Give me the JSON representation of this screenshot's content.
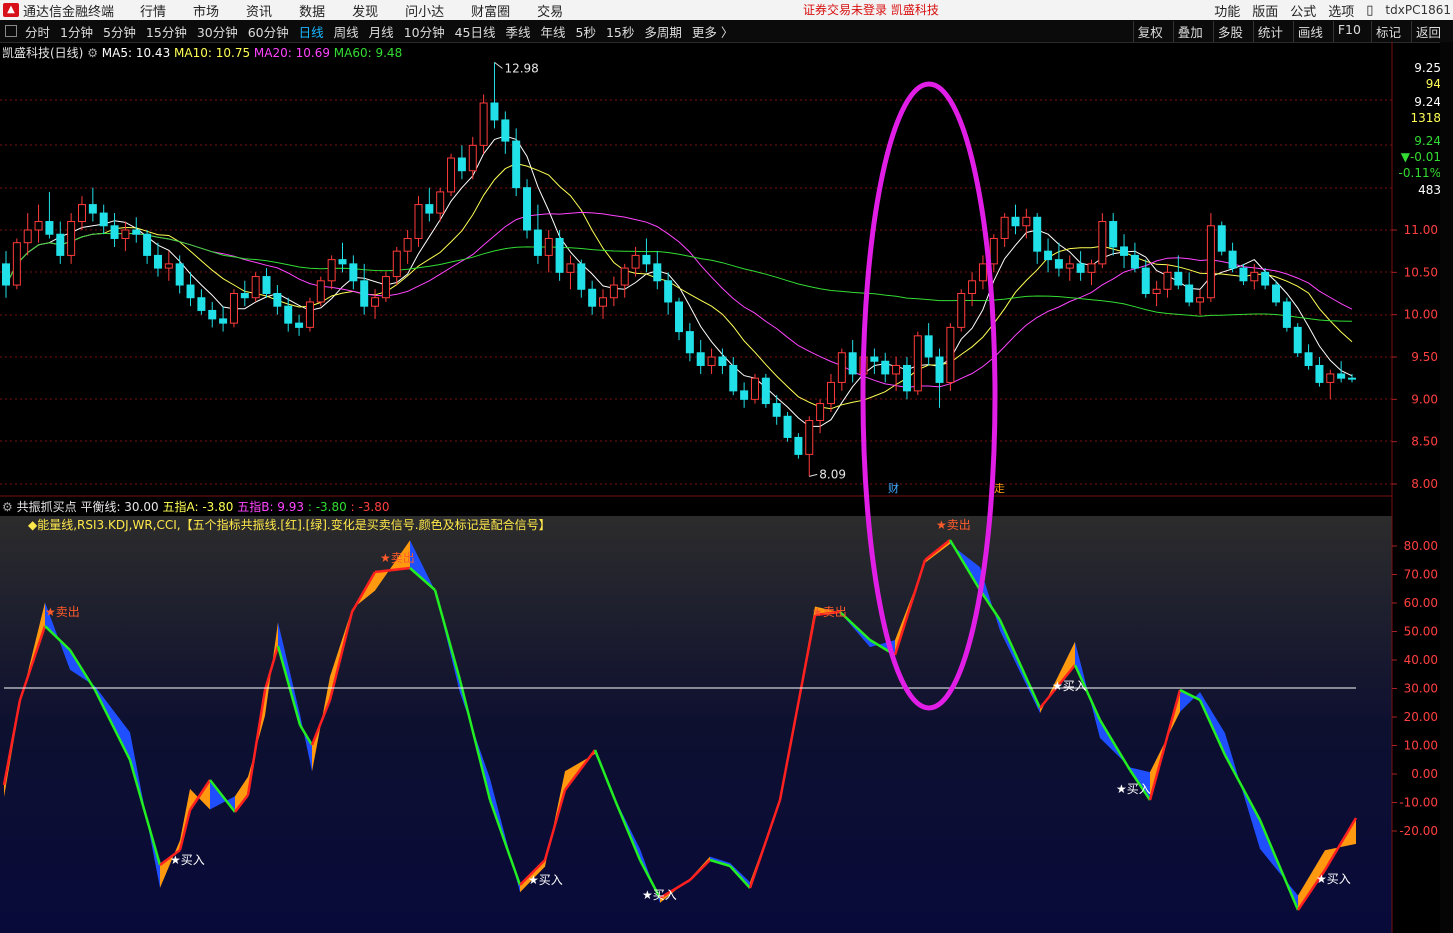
{
  "menubar": {
    "app_name": "通达信金融终端",
    "items": [
      "行情",
      "市场",
      "资讯",
      "数据",
      "发现",
      "问小达",
      "财富圈",
      "交易"
    ],
    "notice": "证券交易未登录  凯盛科技",
    "right": [
      "功能",
      "版面",
      "公式",
      "选项"
    ],
    "pc_label": "tdxPC1861"
  },
  "toolbar": {
    "periods": [
      "分时",
      "1分钟",
      "5分钟",
      "15分钟",
      "30分钟",
      "60分钟",
      "日线",
      "周线",
      "月线",
      "10分钟",
      "45日线",
      "季线",
      "年线",
      "5秒",
      "15秒",
      "多周期",
      "更多 〉"
    ],
    "active_index": 6,
    "right": [
      "复权",
      "叠加",
      "多股",
      "统计",
      "画线",
      "F10",
      "标记",
      "返回"
    ]
  },
  "main_legend": {
    "title": "凯盛科技(日线)",
    "ma5": "MA5: 10.43",
    "ma10": "MA10: 10.75",
    "ma20": "MA20: 10.69",
    "ma60": "MA60: 9.48",
    "colors": {
      "ma5": "#ffffff",
      "ma10": "#ffff55",
      "ma20": "#ff44ff",
      "ma60": "#33dd33"
    }
  },
  "price_annotations": {
    "high": "12.98",
    "low": "8.09",
    "marker_cai": "财",
    "marker_zou": "走"
  },
  "price_axis": {
    "ticks": [
      "11.00",
      "10.50",
      "10.00",
      "9.50",
      "9.00",
      "8.50",
      "8.00"
    ],
    "quote": [
      "9.25",
      "94",
      "9.24",
      "1318",
      "9.24",
      "▼-0.01",
      "-0.11%",
      "483"
    ]
  },
  "indicator_legend": {
    "name": "共振抓买点",
    "balance": "平衡线: 30.00",
    "a": "五指A: -3.80",
    "b": "五指B: 9.93",
    "c": ": -3.80",
    "d": ": -3.80"
  },
  "indicator_note": "◆能量线,RSI3.KDJ,WR,CCI,【五个指标共振线.[红].[绿].变化是买卖信号.颜色及标记是配合信号】",
  "indicator_axis": {
    "ticks": [
      "80.00",
      "70.00",
      "60.00",
      "50.00",
      "40.00",
      "30.00",
      "20.00",
      "10.00",
      "0.00",
      "-10.00",
      "-20.00"
    ]
  },
  "signals": {
    "sell": "★卖出",
    "buy": "★买入"
  },
  "colors": {
    "up": "#ff3b3b",
    "down": "#21e0e8",
    "grid": "#7a1010",
    "orange": "#ff9a10",
    "blue": "#1f4fff",
    "highlight": "#e11ee6"
  },
  "chart_data": {
    "type": "candlestick",
    "ylim": [
      8.0,
      13.1
    ],
    "ohlc": [
      [
        10.6,
        10.75,
        10.2,
        10.35
      ],
      [
        10.35,
        10.9,
        10.3,
        10.85
      ],
      [
        10.85,
        11.2,
        10.7,
        11.0
      ],
      [
        11.0,
        11.3,
        10.85,
        11.1
      ],
      [
        11.1,
        11.45,
        10.9,
        10.95
      ],
      [
        10.95,
        11.1,
        10.6,
        10.7
      ],
      [
        10.7,
        11.2,
        10.6,
        11.1
      ],
      [
        11.1,
        11.4,
        11.0,
        11.3
      ],
      [
        11.3,
        11.5,
        11.1,
        11.2
      ],
      [
        11.2,
        11.3,
        10.95,
        11.05
      ],
      [
        11.05,
        11.2,
        10.8,
        10.9
      ],
      [
        10.9,
        11.1,
        10.75,
        11.0
      ],
      [
        11.0,
        11.15,
        10.85,
        10.95
      ],
      [
        10.95,
        11.0,
        10.6,
        10.7
      ],
      [
        10.7,
        10.85,
        10.45,
        10.55
      ],
      [
        10.55,
        10.75,
        10.4,
        10.6
      ],
      [
        10.6,
        10.7,
        10.25,
        10.35
      ],
      [
        10.35,
        10.5,
        10.1,
        10.2
      ],
      [
        10.2,
        10.3,
        10.0,
        10.05
      ],
      [
        10.05,
        10.15,
        9.85,
        9.95
      ],
      [
        9.95,
        10.1,
        9.8,
        9.9
      ],
      [
        9.9,
        10.3,
        9.85,
        10.25
      ],
      [
        10.25,
        10.4,
        10.1,
        10.2
      ],
      [
        10.2,
        10.5,
        10.15,
        10.45
      ],
      [
        10.45,
        10.55,
        10.2,
        10.25
      ],
      [
        10.25,
        10.35,
        10.0,
        10.1
      ],
      [
        10.1,
        10.2,
        9.8,
        9.9
      ],
      [
        9.9,
        10.0,
        9.75,
        9.85
      ],
      [
        9.85,
        10.2,
        9.8,
        10.15
      ],
      [
        10.15,
        10.45,
        10.1,
        10.4
      ],
      [
        10.4,
        10.7,
        10.3,
        10.65
      ],
      [
        10.65,
        10.85,
        10.5,
        10.6
      ],
      [
        10.6,
        10.7,
        10.3,
        10.4
      ],
      [
        10.4,
        10.6,
        10.0,
        10.1
      ],
      [
        10.1,
        10.3,
        9.95,
        10.2
      ],
      [
        10.2,
        10.5,
        10.15,
        10.45
      ],
      [
        10.45,
        10.8,
        10.35,
        10.75
      ],
      [
        10.75,
        11.0,
        10.6,
        10.9
      ],
      [
        10.9,
        11.4,
        10.8,
        11.3
      ],
      [
        11.3,
        11.5,
        11.1,
        11.2
      ],
      [
        11.2,
        11.5,
        11.1,
        11.45
      ],
      [
        11.45,
        11.9,
        11.4,
        11.85
      ],
      [
        11.85,
        12.0,
        11.6,
        11.7
      ],
      [
        11.7,
        12.1,
        11.6,
        12.0
      ],
      [
        12.0,
        12.6,
        11.9,
        12.5
      ],
      [
        12.5,
        12.98,
        12.2,
        12.3
      ],
      [
        12.3,
        12.4,
        11.9,
        12.05
      ],
      [
        12.05,
        12.2,
        11.4,
        11.5
      ],
      [
        11.5,
        11.6,
        10.9,
        11.0
      ],
      [
        11.0,
        11.3,
        10.6,
        10.7
      ],
      [
        10.7,
        11.0,
        10.5,
        10.9
      ],
      [
        10.9,
        11.0,
        10.4,
        10.5
      ],
      [
        10.5,
        10.7,
        10.3,
        10.6
      ],
      [
        10.6,
        10.65,
        10.2,
        10.3
      ],
      [
        10.3,
        10.4,
        10.0,
        10.1
      ],
      [
        10.1,
        10.3,
        9.95,
        10.2
      ],
      [
        10.2,
        10.45,
        10.1,
        10.35
      ],
      [
        10.35,
        10.6,
        10.2,
        10.55
      ],
      [
        10.55,
        10.8,
        10.45,
        10.7
      ],
      [
        10.7,
        10.9,
        10.5,
        10.6
      ],
      [
        10.6,
        10.75,
        10.3,
        10.4
      ],
      [
        10.4,
        10.5,
        10.0,
        10.15
      ],
      [
        10.15,
        10.2,
        9.7,
        9.8
      ],
      [
        9.8,
        9.9,
        9.45,
        9.55
      ],
      [
        9.55,
        9.7,
        9.3,
        9.4
      ],
      [
        9.4,
        9.6,
        9.3,
        9.5
      ],
      [
        9.5,
        9.6,
        9.3,
        9.4
      ],
      [
        9.4,
        9.5,
        9.05,
        9.1
      ],
      [
        9.1,
        9.2,
        8.9,
        9.0
      ],
      [
        9.0,
        9.3,
        8.95,
        9.25
      ],
      [
        9.25,
        9.3,
        8.9,
        8.95
      ],
      [
        8.95,
        9.05,
        8.7,
        8.8
      ],
      [
        8.8,
        8.85,
        8.5,
        8.55
      ],
      [
        8.55,
        8.6,
        8.3,
        8.35
      ],
      [
        8.35,
        8.8,
        8.09,
        8.75
      ],
      [
        8.75,
        9.0,
        8.6,
        8.95
      ],
      [
        8.95,
        9.3,
        8.85,
        9.2
      ],
      [
        9.2,
        9.6,
        9.1,
        9.55
      ],
      [
        9.55,
        9.7,
        9.2,
        9.3
      ],
      [
        9.3,
        9.6,
        9.1,
        9.5
      ],
      [
        9.5,
        9.6,
        9.3,
        9.45
      ],
      [
        9.45,
        9.55,
        9.2,
        9.3
      ],
      [
        9.3,
        9.5,
        9.1,
        9.4
      ],
      [
        9.4,
        9.5,
        9.0,
        9.1
      ],
      [
        9.1,
        9.8,
        9.05,
        9.75
      ],
      [
        9.75,
        9.9,
        9.4,
        9.5
      ],
      [
        9.5,
        9.6,
        8.9,
        9.2
      ],
      [
        9.2,
        9.9,
        9.1,
        9.85
      ],
      [
        9.85,
        10.3,
        9.8,
        10.25
      ],
      [
        10.25,
        10.5,
        10.1,
        10.4
      ],
      [
        10.4,
        10.7,
        10.3,
        10.6
      ],
      [
        10.6,
        10.95,
        10.5,
        10.9
      ],
      [
        10.9,
        11.2,
        10.8,
        11.15
      ],
      [
        11.15,
        11.3,
        10.95,
        11.05
      ],
      [
        11.05,
        11.25,
        10.9,
        11.15
      ],
      [
        11.15,
        11.2,
        10.6,
        10.75
      ],
      [
        10.75,
        10.9,
        10.5,
        10.65
      ],
      [
        10.65,
        10.85,
        10.45,
        10.55
      ],
      [
        10.55,
        10.7,
        10.4,
        10.6
      ],
      [
        10.6,
        10.75,
        10.4,
        10.5
      ],
      [
        10.5,
        10.65,
        10.35,
        10.6
      ],
      [
        10.6,
        11.2,
        10.55,
        11.1
      ],
      [
        11.1,
        11.2,
        10.7,
        10.8
      ],
      [
        10.8,
        10.95,
        10.55,
        10.7
      ],
      [
        10.7,
        10.85,
        10.5,
        10.55
      ],
      [
        10.55,
        10.65,
        10.2,
        10.25
      ],
      [
        10.25,
        10.4,
        10.1,
        10.3
      ],
      [
        10.3,
        10.6,
        10.2,
        10.5
      ],
      [
        10.5,
        10.7,
        10.3,
        10.35
      ],
      [
        10.35,
        10.5,
        10.1,
        10.15
      ],
      [
        10.15,
        10.3,
        10.0,
        10.2
      ],
      [
        10.2,
        11.2,
        10.15,
        11.05
      ],
      [
        11.05,
        11.1,
        10.7,
        10.75
      ],
      [
        10.75,
        10.85,
        10.5,
        10.55
      ],
      [
        10.55,
        10.6,
        10.35,
        10.4
      ],
      [
        10.4,
        10.6,
        10.3,
        10.5
      ],
      [
        10.5,
        10.55,
        10.3,
        10.35
      ],
      [
        10.35,
        10.4,
        10.1,
        10.15
      ],
      [
        10.15,
        10.2,
        9.8,
        9.85
      ],
      [
        9.85,
        9.9,
        9.5,
        9.55
      ],
      [
        9.55,
        9.65,
        9.35,
        9.4
      ],
      [
        9.4,
        9.5,
        9.15,
        9.2
      ],
      [
        9.2,
        9.35,
        9.0,
        9.3
      ],
      [
        9.3,
        9.45,
        9.2,
        9.25
      ],
      [
        9.25,
        9.3,
        9.2,
        9.24
      ]
    ]
  }
}
